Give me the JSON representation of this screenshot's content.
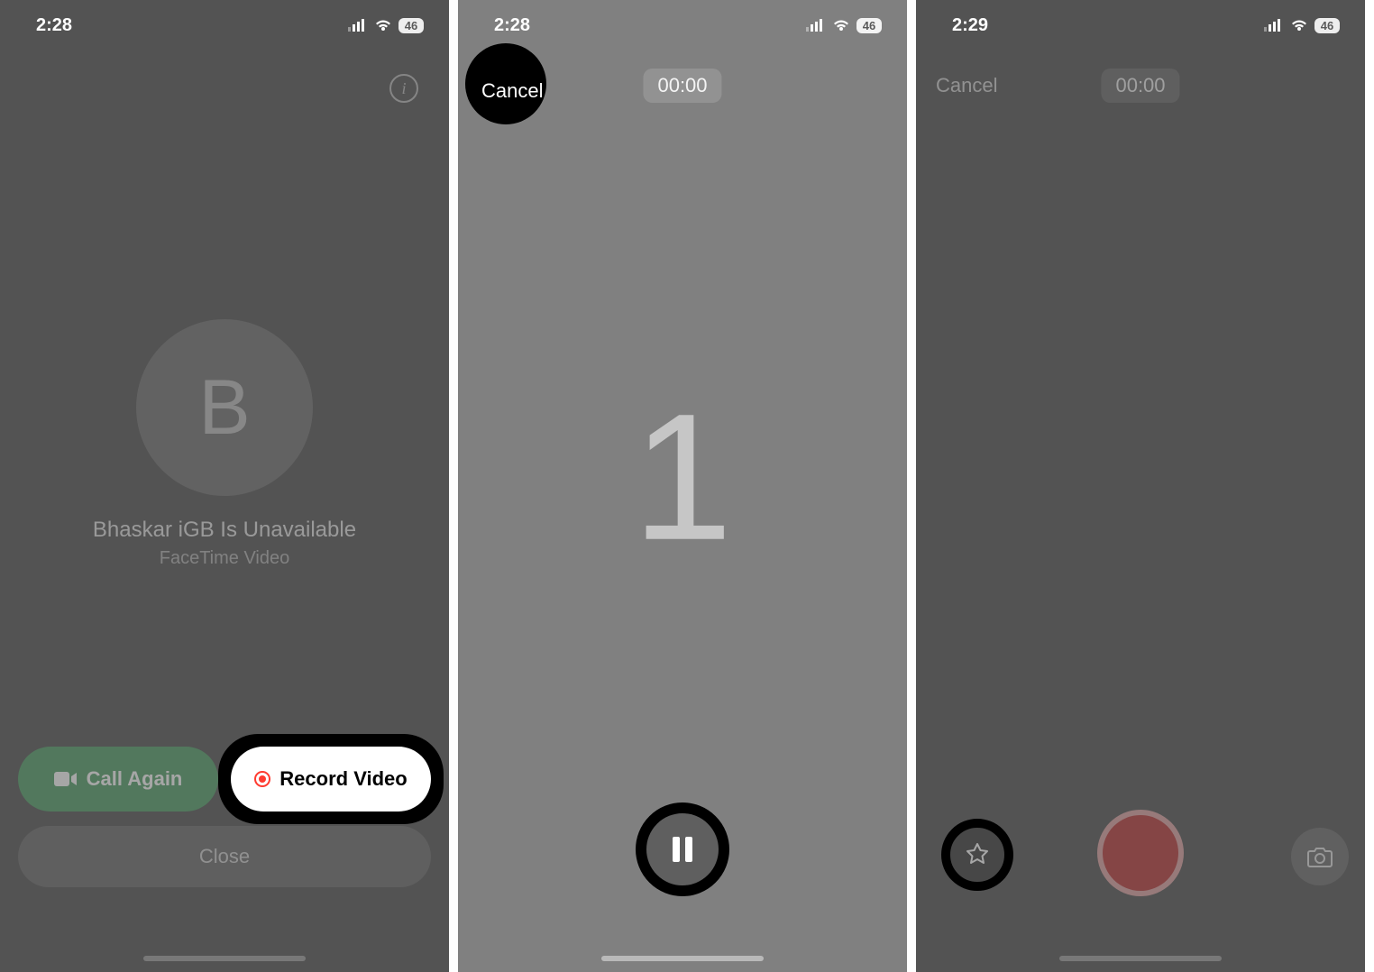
{
  "panel1": {
    "time": "2:28",
    "battery": "46",
    "info_glyph": "i",
    "avatar_initial": "B",
    "contact_status": "Bhaskar iGB Is Unavailable",
    "sub_status": "FaceTime Video",
    "call_again_label": "Call Again",
    "record_video_label": "Record Video",
    "close_label": "Close"
  },
  "panel2": {
    "time": "2:28",
    "battery": "46",
    "cancel_label": "Cancel",
    "timer": "00:00",
    "countdown": "1"
  },
  "panel3": {
    "time": "2:29",
    "battery": "46",
    "cancel_label": "Cancel",
    "timer": "00:00"
  }
}
